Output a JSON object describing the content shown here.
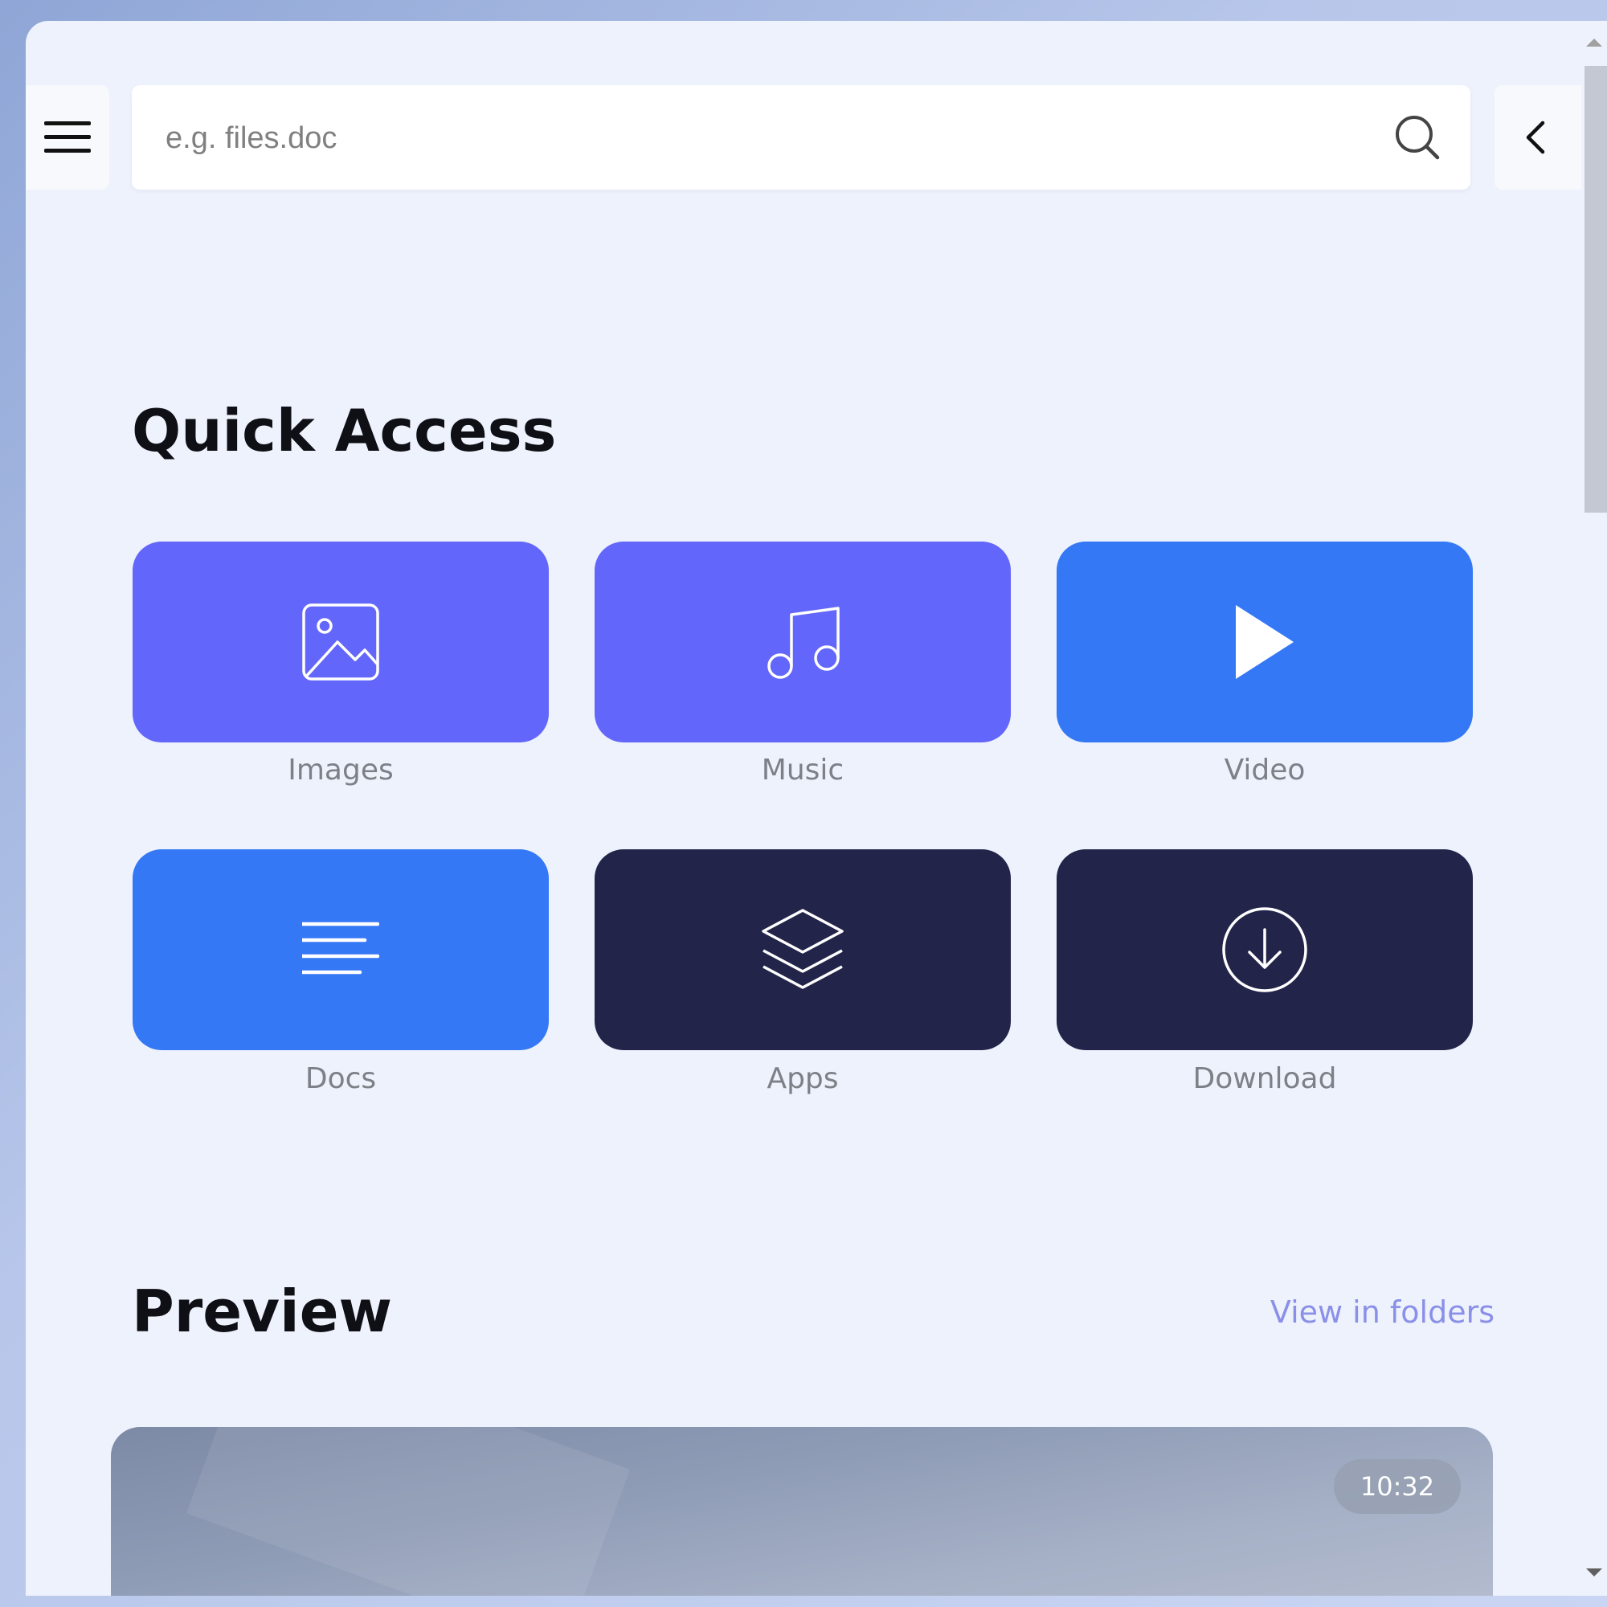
{
  "header": {
    "search": {
      "placeholder": "e.g. files.doc",
      "value": ""
    },
    "menu_icon": "hamburger-icon",
    "search_icon": "search-icon",
    "back_icon": "chevron-left-icon"
  },
  "quick_access": {
    "title": "Quick Access",
    "tiles": [
      {
        "label": "Images",
        "icon": "image-icon",
        "color": "#6366fa"
      },
      {
        "label": "Music",
        "icon": "music-note-icon",
        "color": "#6366fa"
      },
      {
        "label": "Video",
        "icon": "play-icon",
        "color": "#3478f6"
      },
      {
        "label": "Docs",
        "icon": "document-lines-icon",
        "color": "#3478f6"
      },
      {
        "label": "Apps",
        "icon": "layers-icon",
        "color": "#22244a"
      },
      {
        "label": "Download",
        "icon": "download-circle-icon",
        "color": "#22244a"
      }
    ]
  },
  "preview": {
    "title": "Preview",
    "view_link": "View in folders",
    "card": {
      "duration": "10:32"
    }
  },
  "colors": {
    "accent_purple": "#6366fa",
    "accent_blue": "#3478f6",
    "dark_navy": "#22244a",
    "link": "#8a90e8",
    "page_bg": "#eef2fc"
  }
}
